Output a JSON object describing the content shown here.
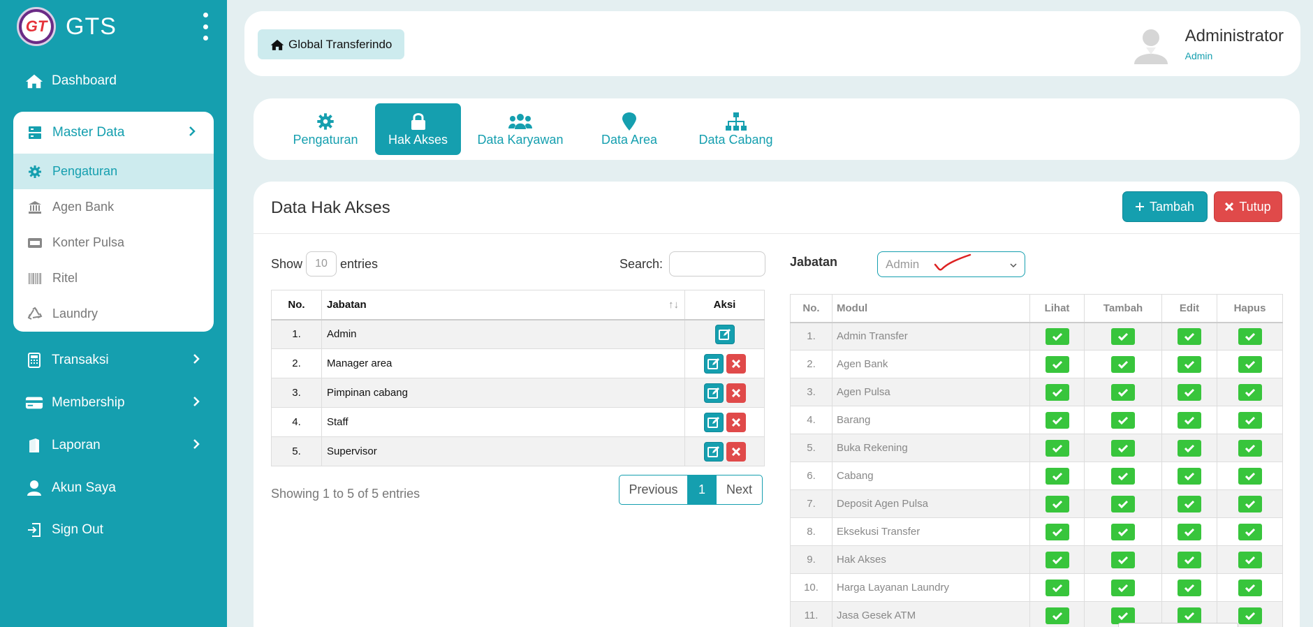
{
  "brand": {
    "name": "GTS",
    "logo_text": "GT"
  },
  "sidebar": {
    "dashboard": "Dashboard",
    "master_data": {
      "label": "Master Data",
      "items": [
        {
          "label": "Pengaturan",
          "icon": "gear-icon",
          "active": true
        },
        {
          "label": "Agen Bank",
          "icon": "bank-icon"
        },
        {
          "label": "Konter Pulsa",
          "icon": "wallet-icon"
        },
        {
          "label": "Ritel",
          "icon": "barcode-icon"
        },
        {
          "label": "Laundry",
          "icon": "recycle-icon"
        }
      ]
    },
    "transaksi": "Transaksi",
    "membership": "Membership",
    "laporan": "Laporan",
    "akun_saya": "Akun Saya",
    "sign_out": "Sign Out"
  },
  "header": {
    "home_label": "Global Transferindo",
    "user_name": "Administrator",
    "user_role": "Admin"
  },
  "tabs": [
    {
      "label": "Pengaturan",
      "icon": "gear-icon"
    },
    {
      "label": "Hak Akses",
      "icon": "lock-icon",
      "active": true
    },
    {
      "label": "Data Karyawan",
      "icon": "users-icon"
    },
    {
      "label": "Data Area",
      "icon": "map-pin-icon"
    },
    {
      "label": "Data Cabang",
      "icon": "sitemap-icon"
    }
  ],
  "main": {
    "title": "Data Hak Akses",
    "tambah_label": "Tambah",
    "tutup_label": "Tutup",
    "show_label": "Show",
    "entries_value": "10",
    "entries_label": "entries",
    "search_label": "Search:",
    "search_value": "",
    "table": {
      "headers": [
        "No.",
        "Jabatan",
        "Aksi"
      ],
      "rows": [
        {
          "no": "1.",
          "jabatan": "Admin",
          "deletable": false
        },
        {
          "no": "2.",
          "jabatan": "Manager area",
          "deletable": true
        },
        {
          "no": "3.",
          "jabatan": "Pimpinan cabang",
          "deletable": true
        },
        {
          "no": "4.",
          "jabatan": "Staff",
          "deletable": true
        },
        {
          "no": "5.",
          "jabatan": "Supervisor",
          "deletable": true
        }
      ]
    },
    "showing_text": "Showing 1 to 5 of 5 entries",
    "pager": {
      "prev": "Previous",
      "current": "1",
      "next": "Next"
    }
  },
  "access": {
    "jabatan_label": "Jabatan",
    "jabatan_selected": "Admin",
    "headers": [
      "No.",
      "Modul",
      "Lihat",
      "Tambah",
      "Edit",
      "Hapus"
    ],
    "rows": [
      {
        "no": "1.",
        "modul": "Admin Transfer"
      },
      {
        "no": "2.",
        "modul": "Agen Bank"
      },
      {
        "no": "3.",
        "modul": "Agen Pulsa"
      },
      {
        "no": "4.",
        "modul": "Barang"
      },
      {
        "no": "5.",
        "modul": "Buka Rekening"
      },
      {
        "no": "6.",
        "modul": "Cabang"
      },
      {
        "no": "7.",
        "modul": "Deposit Agen Pulsa"
      },
      {
        "no": "8.",
        "modul": "Eksekusi Transfer"
      },
      {
        "no": "9.",
        "modul": "Hak Akses"
      },
      {
        "no": "10.",
        "modul": "Harga Layanan Laundry"
      },
      {
        "no": "11.",
        "modul": "Jasa Gesek ATM"
      }
    ]
  },
  "colors": {
    "primary": "#159faf",
    "danger": "#e04a4a",
    "success": "#38c53c"
  }
}
